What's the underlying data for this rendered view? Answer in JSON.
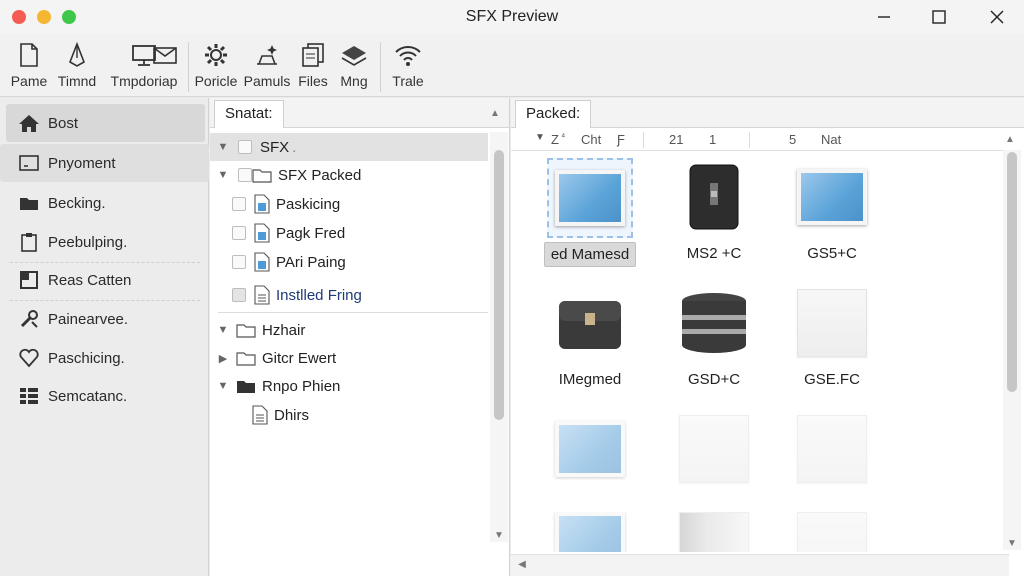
{
  "window": {
    "title": "SFX Preview"
  },
  "toolbar": [
    {
      "label": "Pame",
      "icon": "document-icon"
    },
    {
      "label": "Timnd",
      "icon": "pen-nib-icon"
    },
    {
      "label": "Tmpdoriap",
      "icon": "monitor-icon"
    },
    {
      "label": "",
      "icon": "envelope-icon"
    },
    {
      "label": "Poricle",
      "icon": "gear-icon"
    },
    {
      "label": "Pamuls",
      "icon": "sparkle-icon"
    },
    {
      "label": "Files",
      "icon": "files-icon"
    },
    {
      "label": "Mng",
      "icon": "layers-icon"
    },
    {
      "label": "Trale",
      "icon": "wifi-icon"
    }
  ],
  "sidebar": {
    "items": [
      {
        "label": "Bost",
        "icon": "home-icon"
      },
      {
        "label": "Pnyoment",
        "icon": "window-icon"
      },
      {
        "label": "Becking.",
        "icon": "folder-dark-icon"
      },
      {
        "label": "Peebulping.",
        "icon": "clipboard-icon"
      },
      {
        "label": "Reas Catten",
        "icon": "square-icon"
      },
      {
        "label": "Painearvee.",
        "icon": "tools-icon"
      },
      {
        "label": "Paschicing.",
        "icon": "heart-outline-icon"
      },
      {
        "label": "Semcatanc.",
        "icon": "list-icon"
      }
    ]
  },
  "tree": {
    "tab": "Snatat:",
    "rows": [
      {
        "label": "SFX",
        "suffix": ".",
        "expanded": true,
        "indent": 0,
        "selected": true
      },
      {
        "label": "SFX Packed",
        "expanded": true,
        "indent": 0
      },
      {
        "label": "Paskicing",
        "indent": 1
      },
      {
        "label": "Pagk Fred",
        "indent": 1
      },
      {
        "label": "PAri Paing",
        "indent": 1
      },
      {
        "label": "Instlled Fring",
        "indent": 1
      },
      {
        "label": "Hzhair",
        "expanded": true,
        "indent": 0
      },
      {
        "label": "Gitcr Ewert",
        "expanded": false,
        "indent": 0
      },
      {
        "label": "Rnpo Phien",
        "expanded": true,
        "indent": 0
      },
      {
        "label": "Dhirs",
        "indent": 1
      }
    ]
  },
  "grid": {
    "tab": "Packed:",
    "columns": [
      "Z",
      "Cht",
      "Ƒ",
      "21",
      "1",
      "5",
      "Nat"
    ],
    "items": [
      {
        "label": "ed Mamesd",
        "thumb": "photo",
        "selected": true
      },
      {
        "label": "MS2 +C",
        "thumb": "case-dark"
      },
      {
        "label": "GS5+C",
        "thumb": "photo"
      },
      {
        "label": "IMegmed",
        "thumb": "briefcase"
      },
      {
        "label": "GSD+C",
        "thumb": "database"
      },
      {
        "label": "GSE.FC",
        "thumb": "blank"
      },
      {
        "label": "",
        "thumb": "photo-faded"
      },
      {
        "label": "",
        "thumb": "blank-faded"
      },
      {
        "label": "",
        "thumb": "blank-faded"
      },
      {
        "label": "",
        "thumb": "photo-faded"
      },
      {
        "label": "",
        "thumb": "case-faded"
      },
      {
        "label": "",
        "thumb": "blank-faded"
      }
    ]
  }
}
